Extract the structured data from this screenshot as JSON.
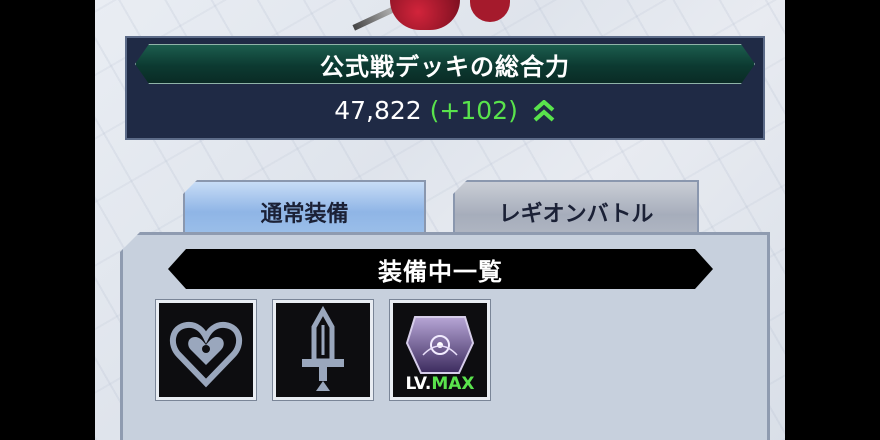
{
  "power_panel": {
    "title": "公式戦デッキの総合力",
    "value": "47,822",
    "delta": "(+102)",
    "trend_icon": "double-chevron-up-icon",
    "delta_color": "#59e34c"
  },
  "tabs": [
    {
      "label": "通常装備",
      "active": true
    },
    {
      "label": "レギオンバトル",
      "active": false
    }
  ],
  "equipment": {
    "title": "装備中一覧",
    "slots": [
      {
        "icon": "heart-crest-icon"
      },
      {
        "icon": "sword-icon"
      },
      {
        "icon": "shield-gem-icon",
        "level_prefix": "LV.",
        "level_value": "MAX"
      }
    ]
  }
}
